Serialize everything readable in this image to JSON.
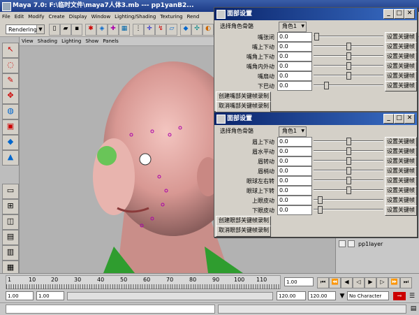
{
  "maya": {
    "title": "Maya 7.0: F:\\临时文件\\maya7人体3.mb  ---  pp1yanB2...",
    "menu": [
      "File",
      "Edit",
      "Modify",
      "Create",
      "Display",
      "Window",
      "Lighting/Shading",
      "Texturing",
      "Rend"
    ],
    "mode_select": "Rendering",
    "viewport_menu": [
      "View",
      "Shading",
      "Lighting",
      "Show",
      "Panels"
    ],
    "layer_name": "pp1layer",
    "timeline": {
      "ticks": [
        "1",
        "10",
        "20",
        "30",
        "40",
        "50",
        "60",
        "70",
        "80",
        "90",
        "100",
        "110",
        "120"
      ],
      "current_frame": "1.00",
      "range_start": "1.00",
      "playback_start": "1.00",
      "playback_end": "120.00",
      "range_end": "120.00",
      "character_set": "No Character Set"
    }
  },
  "mouth_dialog": {
    "title": "面部设置",
    "select_label": "选择角色骨骼",
    "role": "角色1",
    "rows": [
      {
        "label": "嘴张闭",
        "value": "0.0",
        "slider": 0.0,
        "key": "设置关键帧"
      },
      {
        "label": "嘴上下动",
        "value": "0.0",
        "slider": 0.5,
        "key": "设置关键帧"
      },
      {
        "label": "嘴角上下动",
        "value": "0.0",
        "slider": 0.5,
        "key": "设置关键帧"
      },
      {
        "label": "嘴角内外动",
        "value": "0.0",
        "slider": 0.5,
        "key": "设置关键帧"
      },
      {
        "label": "嘴扇动",
        "value": "0.0",
        "slider": 0.5,
        "key": "设置关键帧"
      },
      {
        "label": "下巴动",
        "value": "0.0",
        "slider": 0.15,
        "key": "设置关键帧"
      }
    ],
    "create_btn": "创建嘴部关键帧录制",
    "cancel_btn": "取消嘴部关键帧录制"
  },
  "eye_dialog": {
    "title": "面部设置",
    "select_label": "选择角色骨骼",
    "role": "角色1",
    "rows": [
      {
        "label": "眉上下动",
        "value": "0.0",
        "slider": 0.5,
        "key": "设置关键帧"
      },
      {
        "label": "眉水平动",
        "value": "0.0",
        "slider": 0.5,
        "key": "设置关键帧"
      },
      {
        "label": "眉转动",
        "value": "0.0",
        "slider": 0.5,
        "key": "设置关键帧"
      },
      {
        "label": "眉梢动",
        "value": "0.0",
        "slider": 0.5,
        "key": "设置关键帧"
      },
      {
        "label": "眼球左右转",
        "value": "0.0",
        "slider": 0.5,
        "key": "设置关键帧"
      },
      {
        "label": "眼球上下转",
        "value": "0.0",
        "slider": 0.5,
        "key": "设置关键帧"
      },
      {
        "label": "上眼皮动",
        "value": "0.0",
        "slider": 0.05,
        "key": "设置关键帧"
      },
      {
        "label": "下眼皮动",
        "value": "0.0",
        "slider": 0.05,
        "key": "设置关键帧"
      }
    ],
    "create_btn": "创建眼部关键帧录制",
    "cancel_btn": "取消眼部关键帧录制"
  }
}
